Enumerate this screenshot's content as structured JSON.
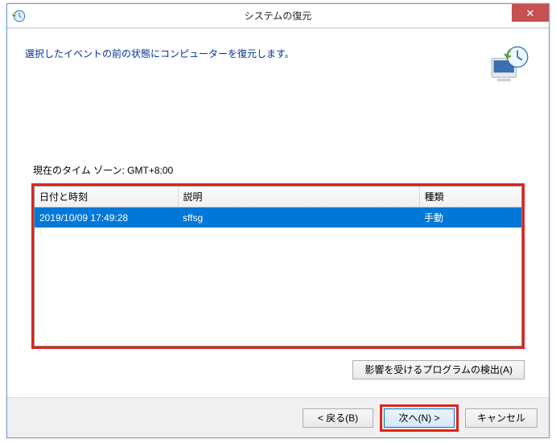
{
  "title": "システムの復元",
  "heading": "選択したイベントの前の状態にコンピューターを復元します。",
  "timezone_label": "現在のタイム ゾーン: GMT+8:00",
  "columns": {
    "datetime": "日付と時刻",
    "description": "説明",
    "type": "種類"
  },
  "rows": [
    {
      "datetime": "2019/10/09 17:49:28",
      "description": "sffsg",
      "type": "手動"
    }
  ],
  "scan_button": "影響を受けるプログラムの検出(A)",
  "buttons": {
    "back": "< 戻る(B)",
    "next": "次へ(N) >",
    "cancel": "キャンセル"
  },
  "close_glyph": "✕"
}
